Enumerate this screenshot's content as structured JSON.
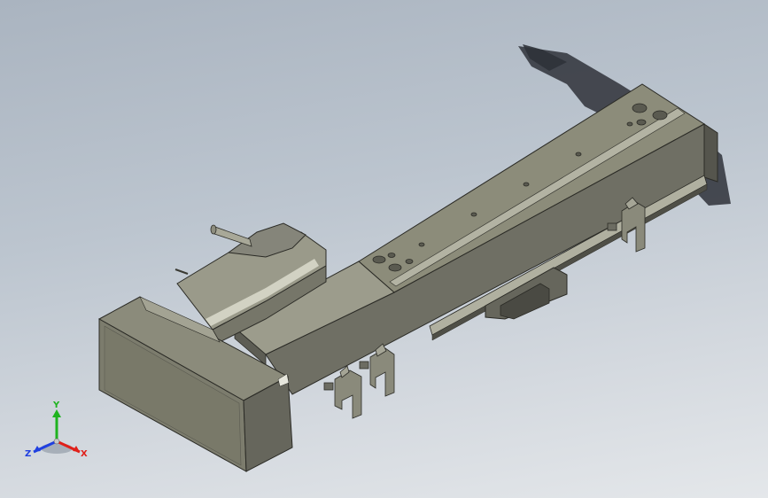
{
  "triad": {
    "x_label": "X",
    "y_label": "Y",
    "z_label": "Z",
    "x_color": "#e0201a",
    "y_color": "#1fb31f",
    "z_color": "#2040e0"
  },
  "colors": {
    "body_top": "#8c8c7a",
    "body_front": "#75756a",
    "body_side": "#5e5e55",
    "rail_top": "#a3a394",
    "shadow": "#3a3d44"
  }
}
